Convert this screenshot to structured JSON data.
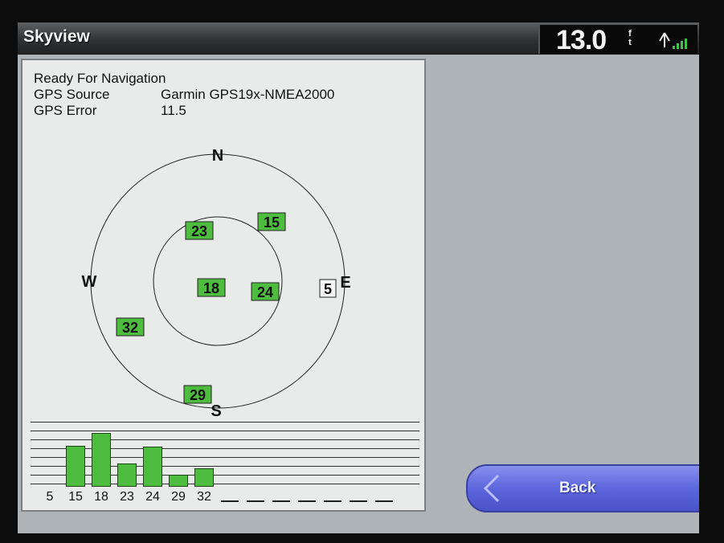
{
  "window": {
    "title": "Skyview"
  },
  "depth": {
    "value": "13.0",
    "unit_top": "f",
    "unit_bottom": "t",
    "icon": "gps-signal-icon"
  },
  "status": {
    "ready_text": "Ready For Navigation",
    "source_label": "GPS Source",
    "source_value": "Garmin GPS19x-NMEA2000",
    "error_label": "GPS Error",
    "error_value": "11.5"
  },
  "compass": {
    "n": "N",
    "s": "S",
    "e": "E",
    "w": "W"
  },
  "satellites": [
    {
      "id": "23",
      "locked": true
    },
    {
      "id": "15",
      "locked": true
    },
    {
      "id": "18",
      "locked": true
    },
    {
      "id": "24",
      "locked": true
    },
    {
      "id": "5",
      "locked": false
    },
    {
      "id": "32",
      "locked": true
    },
    {
      "id": "29",
      "locked": true
    }
  ],
  "signal": {
    "labels": [
      "5",
      "15",
      "18",
      "23",
      "24",
      "29",
      "32"
    ],
    "strength": [
      0,
      0.63,
      0.83,
      0.36,
      0.62,
      0.19,
      0.29
    ],
    "empty_slots": 7
  },
  "colors": {
    "locked": "#4ebc3e",
    "button": "#5d66dc"
  },
  "buttons": {
    "back": "Back"
  }
}
